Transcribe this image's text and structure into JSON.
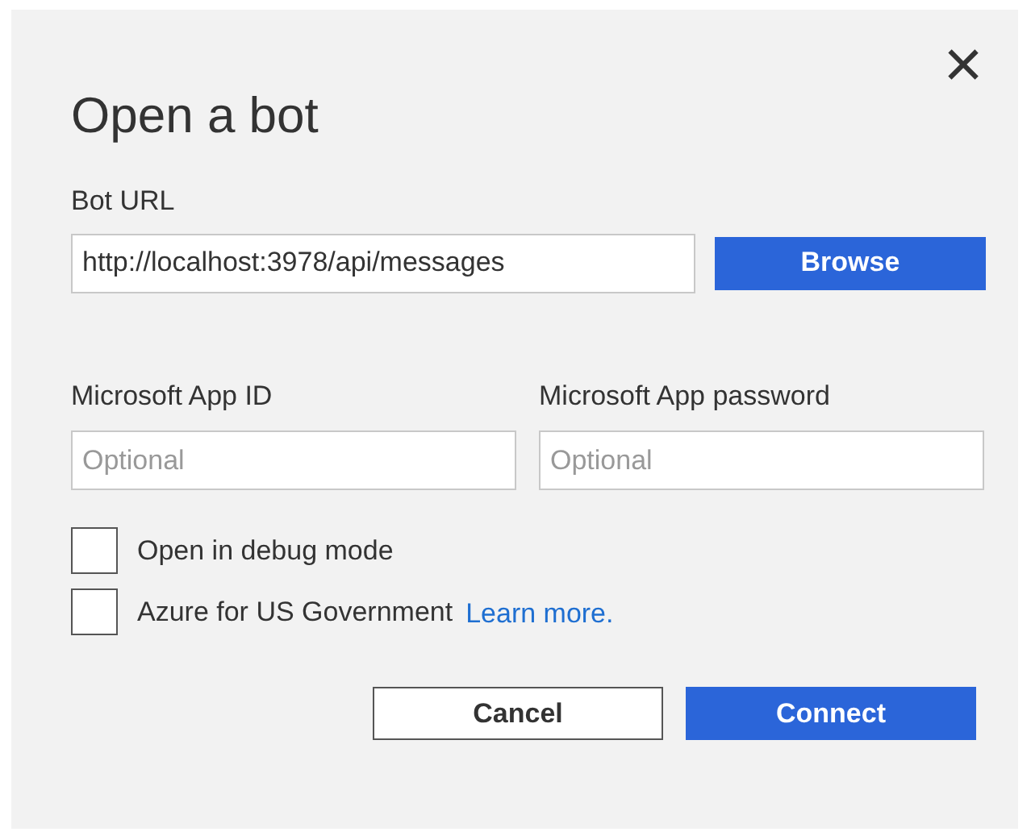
{
  "dialog": {
    "title": "Open a bot",
    "close": "×"
  },
  "bot_url": {
    "label": "Bot URL",
    "value": "http://localhost:3978/api/messages"
  },
  "browse_button": "Browse",
  "fields": [
    {
      "label": "Microsoft App ID",
      "placeholder": "Optional"
    },
    {
      "label": "Microsoft App password",
      "placeholder": "Optional"
    }
  ],
  "checkboxes": [
    {
      "label": "Open in debug mode",
      "checked": false
    },
    {
      "label": "Azure for US Government",
      "checked": false,
      "link": "Learn more."
    }
  ],
  "buttons": [
    {
      "label": "Cancel",
      "kind": "secondary"
    },
    {
      "label": "Connect",
      "kind": "primary"
    }
  ]
}
